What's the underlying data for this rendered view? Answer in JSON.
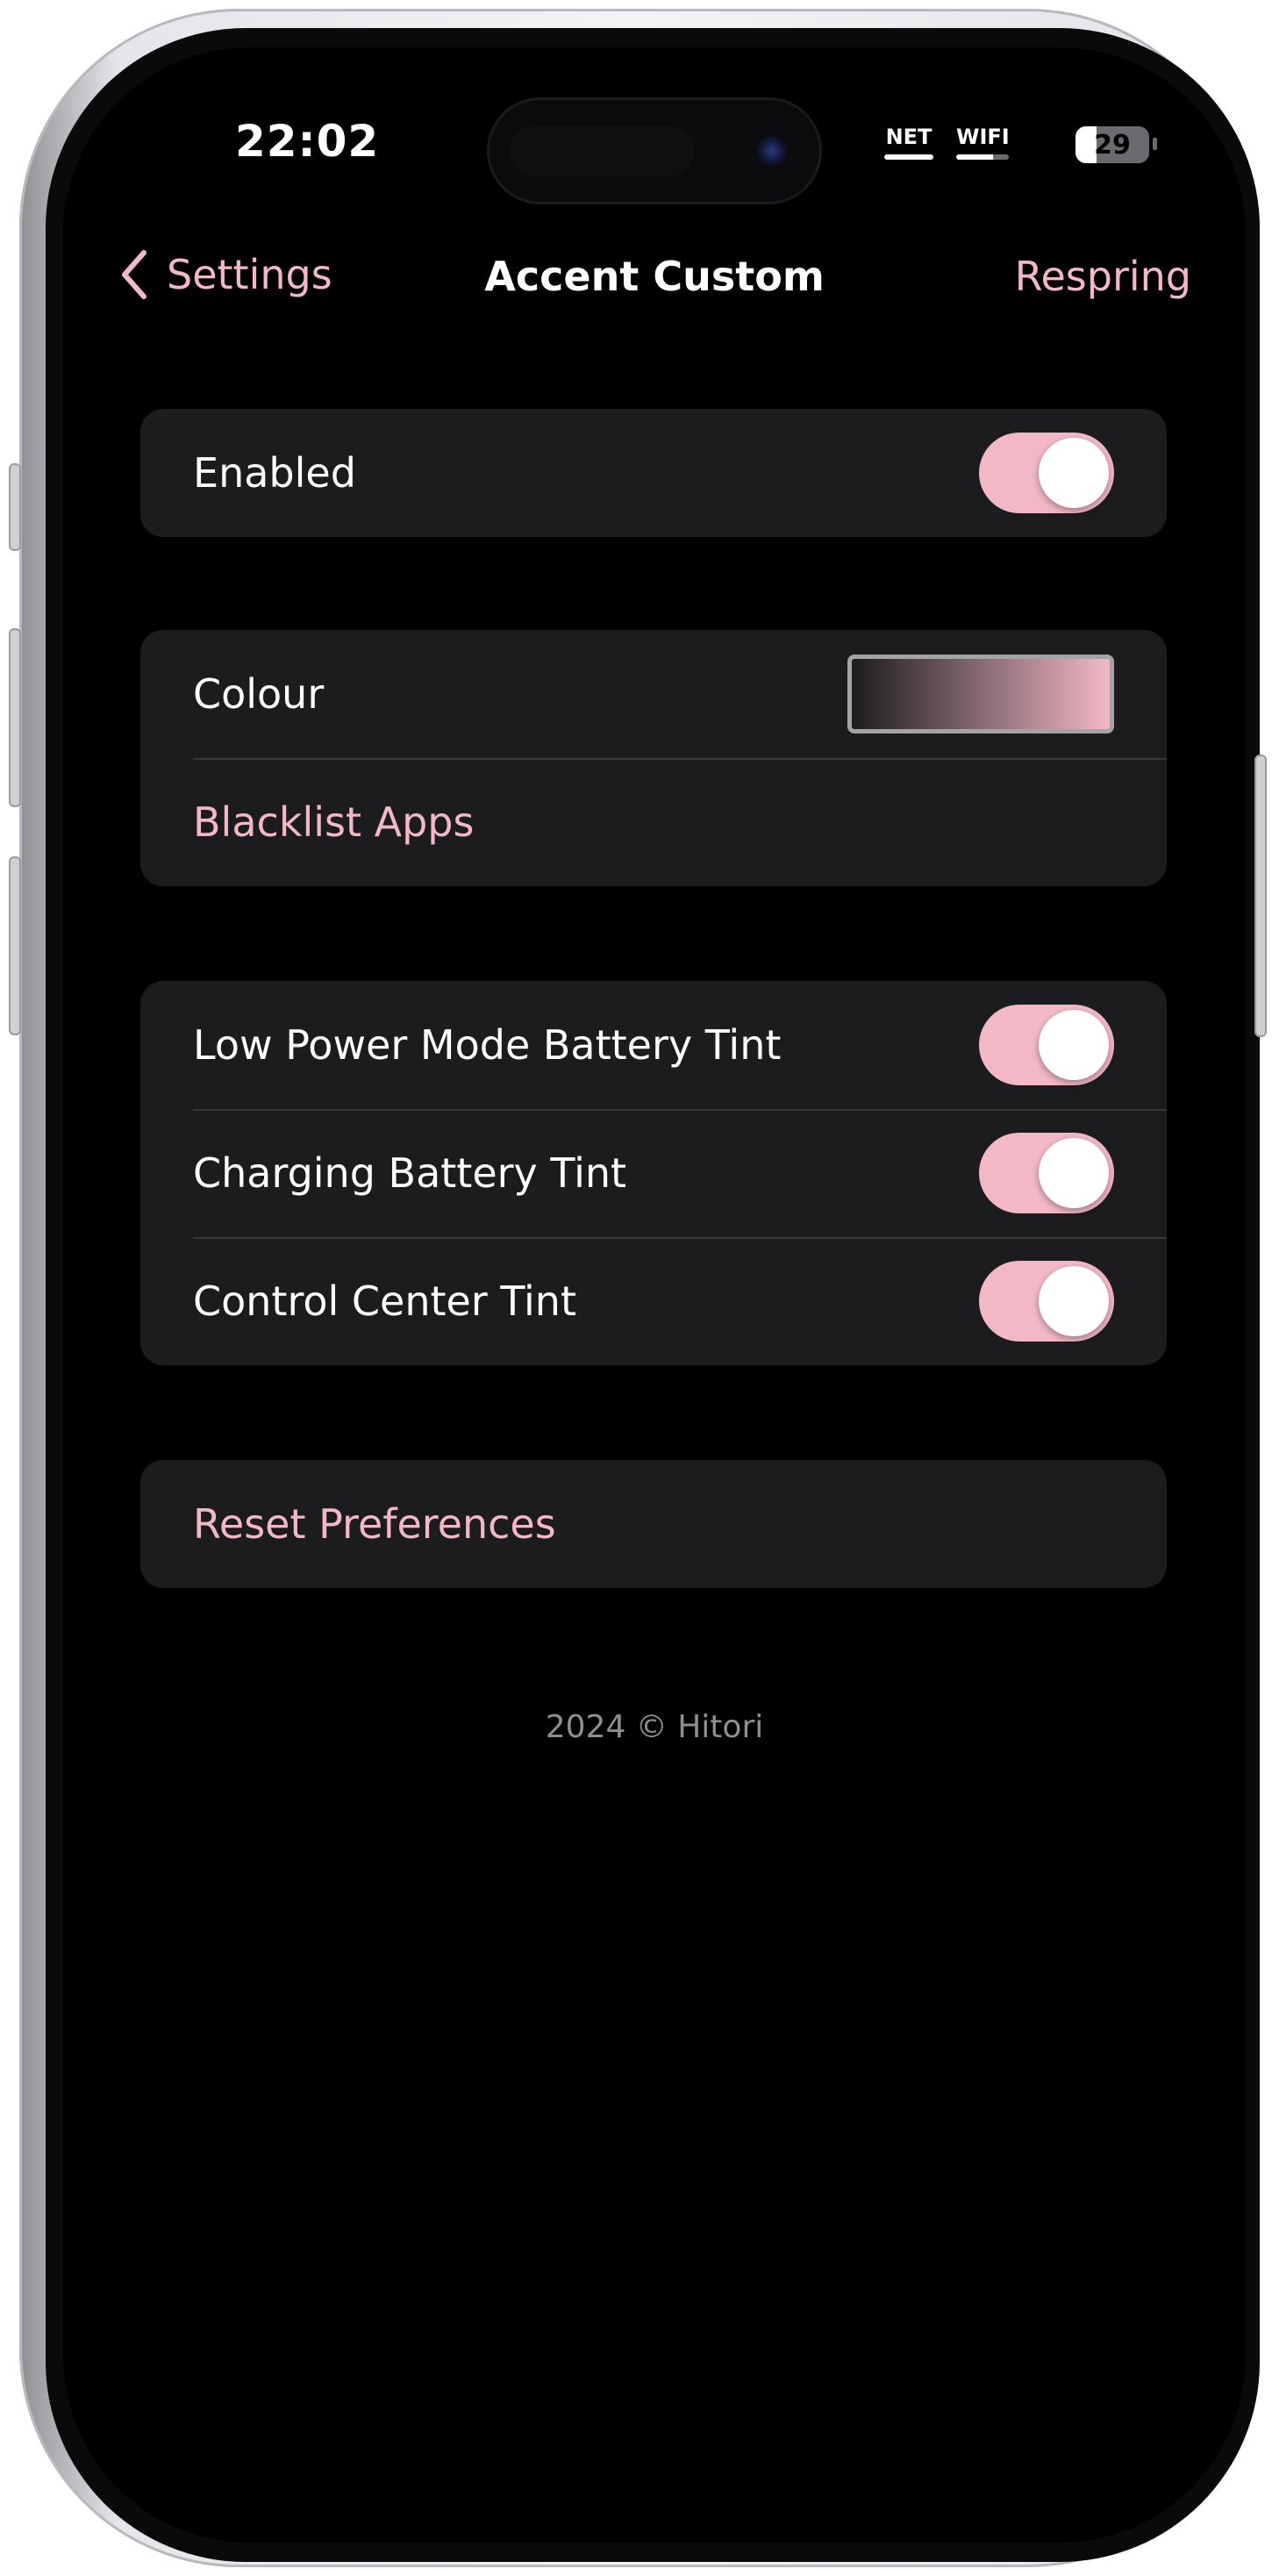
{
  "status_bar": {
    "time": "22:02",
    "net_label": "NET",
    "wifi_label": "WIFI",
    "battery_level": "29",
    "battery_fraction": 0.29
  },
  "nav": {
    "back_label": "Settings",
    "title": "Accent Custom",
    "action_label": "Respring"
  },
  "groups": {
    "main": {
      "enabled_label": "Enabled",
      "enabled_on": true
    },
    "colour": {
      "colour_label": "Colour",
      "colour_gradient": [
        "#1c1c1e",
        "#f2b8c6"
      ],
      "blacklist_label": "Blacklist Apps"
    },
    "tints": {
      "low_power_label": "Low Power Mode Battery Tint",
      "low_power_on": true,
      "charging_label": "Charging Battery Tint",
      "charging_on": true,
      "control_center_label": "Control Center Tint",
      "control_center_on": true
    },
    "reset": {
      "reset_label": "Reset Preferences"
    }
  },
  "footer": {
    "text": "2024 © Hitori"
  },
  "colors": {
    "accent": "#f2b8c6",
    "background": "#000000",
    "cell": "#1c1c1e",
    "separator": "#38383a",
    "footer_text": "#8e8e93"
  }
}
